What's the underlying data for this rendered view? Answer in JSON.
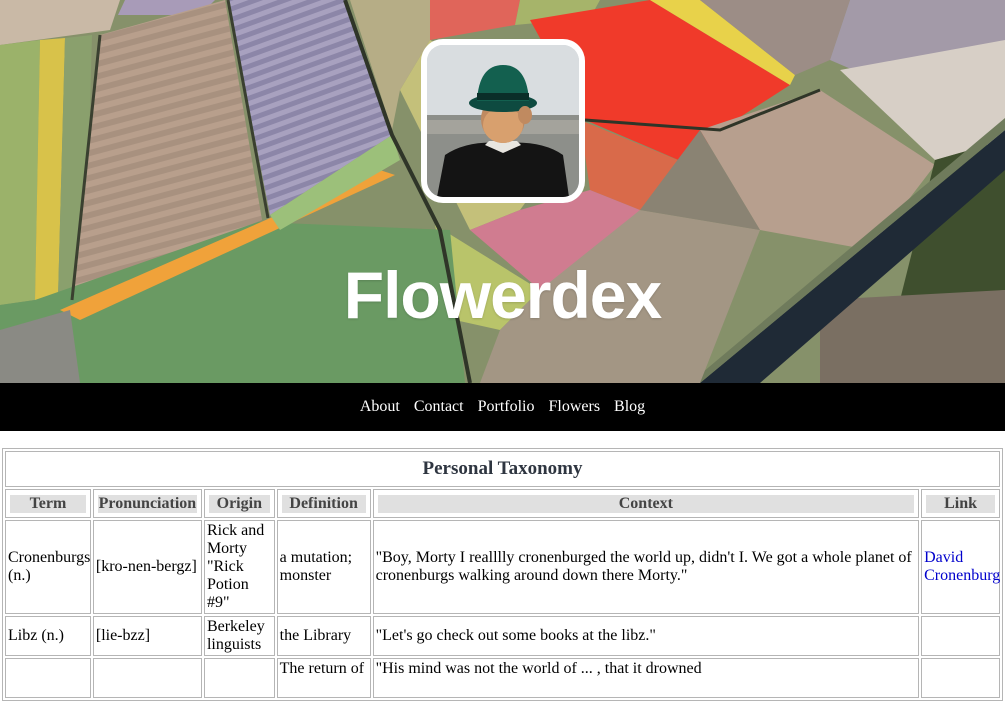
{
  "site": {
    "title": "Flowerdex"
  },
  "nav": {
    "items": [
      "About",
      "Contact",
      "Portfolio",
      "Flowers",
      "Blog"
    ]
  },
  "taxonomy": {
    "caption": "Personal Taxonomy",
    "columns": [
      "Term",
      "Pronunciation",
      "Origin",
      "Definition",
      "Context",
      "Link"
    ],
    "rows": [
      {
        "term": "Cronenburgs (n.)",
        "pronunciation": "[kro-nen-bergz]",
        "origin": "Rick and Morty \"Rick Potion #9\"",
        "definition": "a mutation; monster",
        "context": "\"Boy, Morty I realllly cronenburged the world up, didn't I. We got a whole planet of cronenburgs walking around down there Morty.\"",
        "link": "David Cronenburg"
      },
      {
        "term": "Libz (n.)",
        "pronunciation": "[lie-bzz]",
        "origin": "Berkeley linguists",
        "definition": "the Library",
        "context": "\"Let's go check out some books at the libz.\"",
        "link": ""
      },
      {
        "term": "",
        "pronunciation": "",
        "origin": "",
        "definition": "The return of",
        "context": "\"His mind was not the world of ... , that it drowned",
        "link": ""
      }
    ]
  },
  "colors": {
    "nav_background": "#000000",
    "nav_text": "#ffffff",
    "link": "#0000cc",
    "header_cell_background": "#e0e0e0",
    "caption_text": "#2e3540"
  },
  "images": {
    "hero": "aerial-tulip-fields",
    "avatar": "person-in-green-hat"
  }
}
